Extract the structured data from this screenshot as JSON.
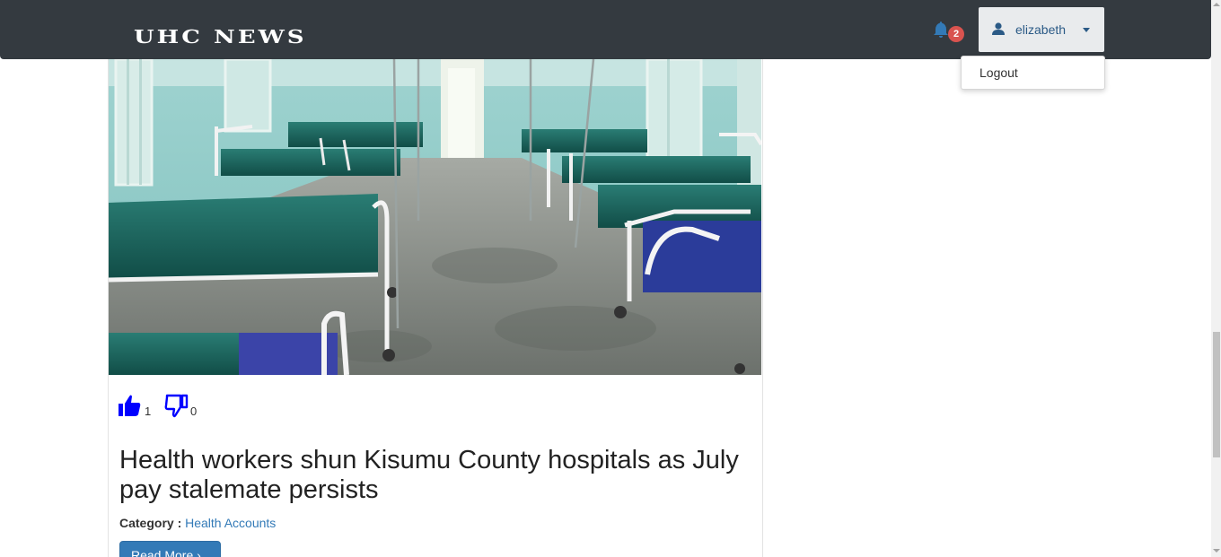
{
  "brand": {
    "title": "UHC NEWS"
  },
  "notifications": {
    "count": "2",
    "icon": "bell-icon"
  },
  "user": {
    "name": "elizabeth",
    "icon": "user-icon"
  },
  "user_menu": {
    "items": [
      {
        "label": "Logout"
      }
    ]
  },
  "post": {
    "image_description_icon": "hospital-ward-photo",
    "likes": "1",
    "dislikes": "0",
    "title": "Health workers shun Kisumu County hospitals as July pay stalemate persists",
    "category_label": "Category :",
    "category_value": "Health Accounts",
    "read_more_label": "Read More ›"
  },
  "colors": {
    "navbar": "#343a40",
    "link": "#337ab7",
    "button": "#337ab7",
    "badge": "#d9534f",
    "reaction_icon": "#0000ff"
  }
}
